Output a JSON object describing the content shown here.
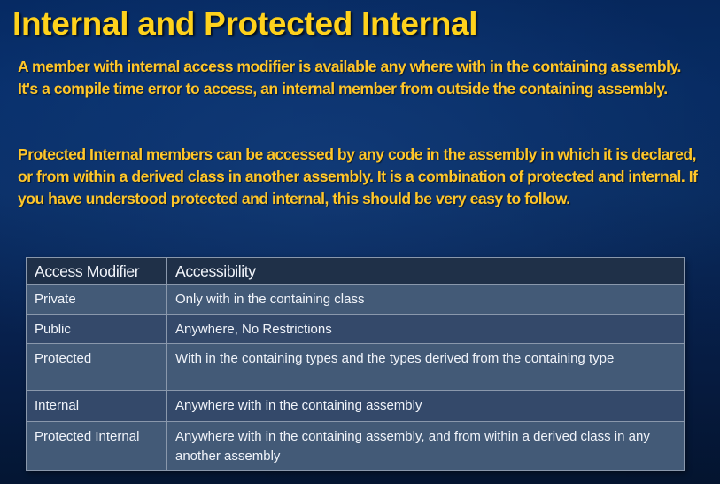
{
  "slide": {
    "title": "Internal and Protected Internal",
    "paragraphs": [
      "A member with internal access modifier is available any where with in the containing assembly. It's a compile time error to access, an internal member from outside the containing assembly.",
      "Protected Internal members can be accessed by any code in the assembly in which it is declared, or from within a derived class in another assembly. It is a combination of protected and internal. If you have understood protected and internal, this should be very easy to follow."
    ]
  },
  "table": {
    "headers": [
      "Access Modifier",
      "Accessibility"
    ],
    "rows": [
      [
        "Private",
        "Only with in the containing class"
      ],
      [
        "Public",
        "Anywhere, No Restrictions"
      ],
      [
        "Protected",
        "With in the containing types and the types derived from the containing type"
      ],
      [
        "Internal",
        "Anywhere with in the containing assembly"
      ],
      [
        "Protected Internal",
        "Anywhere with in the containing assembly, and from within a derived class in any another assembly"
      ]
    ]
  },
  "colors": {
    "title": "#ffd21c",
    "body_text": "#ffc629",
    "background": "#0a2f67",
    "table_header": "#1f3048",
    "table_row_light": "#435a77",
    "table_row_dark": "#34496a"
  }
}
